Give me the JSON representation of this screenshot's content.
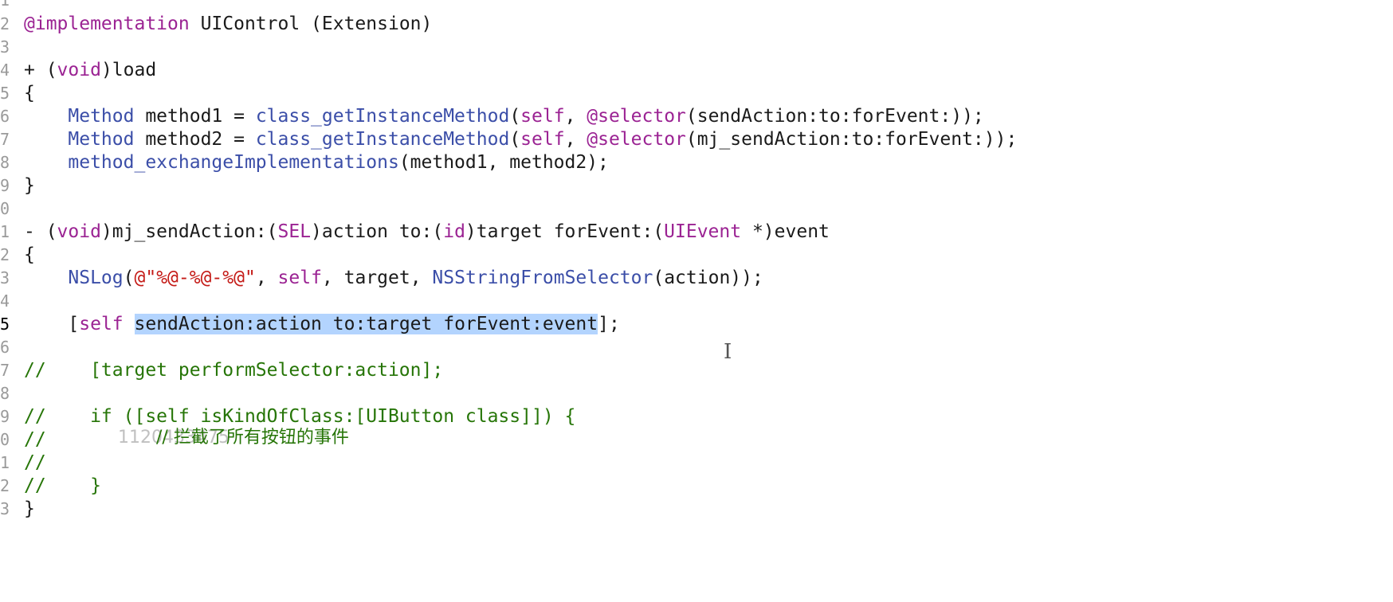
{
  "line_numbers": [
    "1",
    "2",
    "3",
    "4",
    "5",
    "6",
    "7",
    "8",
    "9",
    "0",
    "1",
    "2",
    "3",
    "4",
    "5",
    "6",
    "7",
    "8",
    "9",
    "0",
    "1",
    "2",
    "3"
  ],
  "code": {
    "l2": {
      "a": "@implementation",
      "b": " UIControl (Extension)"
    },
    "l4": {
      "a": "+ (",
      "b": "void",
      ";c": "",
      "c": ")load"
    },
    "l5": {
      "a": "{"
    },
    "l6": {
      "a": "    ",
      "b": "Method",
      "c": " method1 = ",
      "d": "class_getInstanceMethod",
      "e": "(",
      "f": "self",
      "g": ", ",
      "h": "@selector",
      "i": "(sendAction:to:forEvent:));"
    },
    "l7": {
      "a": "    ",
      "b": "Method",
      "c": " method2 = ",
      "d": "class_getInstanceMethod",
      "e": "(",
      "f": "self",
      "g": ", ",
      "h": "@selector",
      "i": "(mj_sendAction:to:forEvent:));"
    },
    "l8": {
      "a": "    ",
      "b": "method_exchangeImplementations",
      "c": "(method1, method2);"
    },
    "l9": {
      "a": "}"
    },
    "l11": {
      "a": "- (",
      "b": "void",
      "c": ")mj_sendAction:(",
      "d": "SEL",
      "e": ")action to:(",
      "f": "id",
      "g": ")target forEvent:(",
      "h": "UIEvent",
      "i": " *)event"
    },
    "l12": {
      "a": "{"
    },
    "l13": {
      "a": "    ",
      "b": "NSLog",
      "c": "(",
      "d": "@\"%@-%@-%@\"",
      "e": ", ",
      "f": "self",
      "g": ", target, ",
      "h": "NSStringFromSelector",
      "i": "(action));"
    },
    "l15": {
      "a": "    [",
      "b": "self",
      "c": " ",
      "d": "sendAction:action to:target forEvent:event",
      "e": "];"
    },
    "l17": {
      "a": "//    [target performSelector:action];"
    },
    "l19": {
      "a": "//    if ([self isKindOfClass:[UIButton class]]) {"
    },
    "l20": {
      "a": "//"
    },
    "l21": {
      "a": "//"
    },
    "l22": {
      "a": "//    }"
    },
    "l23": {
      "a": "}"
    }
  },
  "overlay": {
    "watermark": "1120433475",
    "chinese_comment": "// 拦截了所有按钮的事件"
  },
  "cursor": {
    "glyph": "I"
  },
  "colors": {
    "keyword": "#9b2393",
    "type": "#3b4ea8",
    "string": "#c41a16",
    "comment": "#267507",
    "selection": "#b3d4fe"
  }
}
